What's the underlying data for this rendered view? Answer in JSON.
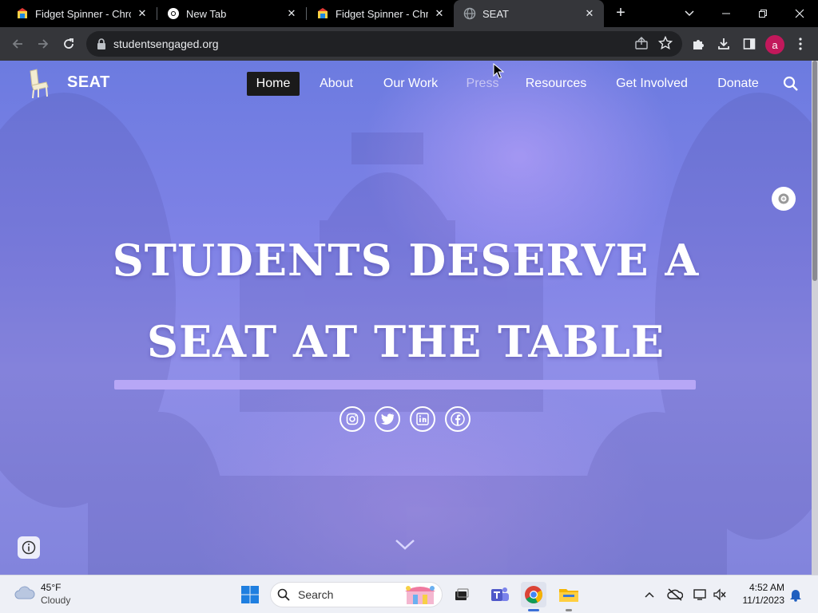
{
  "browser": {
    "tabs": [
      {
        "title": "Fidget Spinner - Chrome",
        "icon": "bounce-house-icon"
      },
      {
        "title": "New Tab",
        "icon": "chrome-icon"
      },
      {
        "title": "Fidget Spinner - Chrome",
        "icon": "bounce-house-icon"
      },
      {
        "title": "SEAT",
        "icon": "globe-icon",
        "active": true
      }
    ],
    "url": "studentsengaged.org",
    "profile_initial": "a"
  },
  "site": {
    "name": "SEAT",
    "nav": [
      {
        "label": "Home",
        "active": true
      },
      {
        "label": "About"
      },
      {
        "label": "Our Work"
      },
      {
        "label": "Press"
      },
      {
        "label": "Resources"
      },
      {
        "label": "Get Involved"
      },
      {
        "label": "Donate"
      }
    ],
    "hero": {
      "line1": "STUDENTS DESERVE A",
      "line2": "SEAT AT THE TABLE"
    },
    "social": [
      "instagram-icon",
      "twitter-icon",
      "linkedin-icon",
      "facebook-icon"
    ]
  },
  "taskbar": {
    "weather_temp": "45°F",
    "weather_desc": "Cloudy",
    "search_label": "Search",
    "time": "4:52 AM",
    "date": "11/1/2023"
  },
  "colors": {
    "hero_bar": "#b7a7f6",
    "nav_active_bg": "#1a1a1a",
    "profile_badge": "#c2185b"
  }
}
